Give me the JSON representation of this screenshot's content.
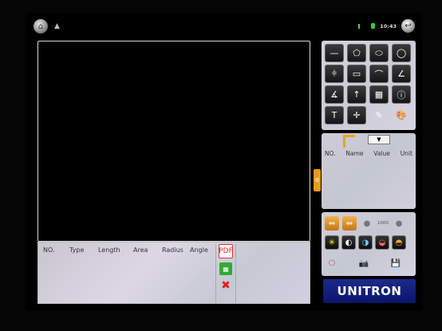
{
  "status": {
    "home_icon": "home-icon",
    "warning_glyph": "▲",
    "time": "10:43"
  },
  "measurement_table": {
    "columns": [
      "NO.",
      "Type",
      "Length",
      "Area",
      "Radius",
      "Angle"
    ],
    "actions": {
      "pdf_glyph": "PDF",
      "excel_glyph": "▦",
      "delete_glyph": "✖"
    }
  },
  "tools": [
    {
      "icon": "line-icon",
      "glyph": "—"
    },
    {
      "icon": "polygon-icon",
      "glyph": "⬠"
    },
    {
      "icon": "ellipse-icon",
      "glyph": "⬭"
    },
    {
      "icon": "circle-icon",
      "glyph": "◯"
    },
    {
      "icon": "parallel-lines-icon",
      "glyph": "⫩"
    },
    {
      "icon": "rectangle-icon",
      "glyph": "▭"
    },
    {
      "icon": "arc-icon",
      "glyph": "⌒"
    },
    {
      "icon": "angle-icon",
      "glyph": "∠"
    },
    {
      "icon": "angle-measure-icon",
      "glyph": "∡"
    },
    {
      "icon": "arrow-icon",
      "glyph": "↑"
    },
    {
      "icon": "grid-icon",
      "glyph": "▦"
    },
    {
      "icon": "info-icon",
      "glyph": "ⓘ"
    },
    {
      "icon": "text-icon",
      "glyph": "T"
    },
    {
      "icon": "crosshair-icon",
      "glyph": "✛"
    },
    {
      "icon": "eraser-icon",
      "glyph": "✎"
    },
    {
      "icon": "palette-icon",
      "glyph": "🎨"
    }
  ],
  "results": {
    "dropdown_glyph": "▼",
    "columns": [
      "NO.",
      "Name",
      "Value",
      "Unit"
    ]
  },
  "camera": {
    "exposure_value": "1000",
    "row1_glyphs": [
      "⇔",
      "⇔",
      "●",
      "●"
    ],
    "row2_glyphs": [
      "✳",
      "◐",
      "◑",
      "◒",
      "◓"
    ],
    "row3_glyphs": [
      "⎔",
      "📷",
      "💾"
    ]
  },
  "side_tab_glyph": "⚙",
  "brand": "UNITRON"
}
